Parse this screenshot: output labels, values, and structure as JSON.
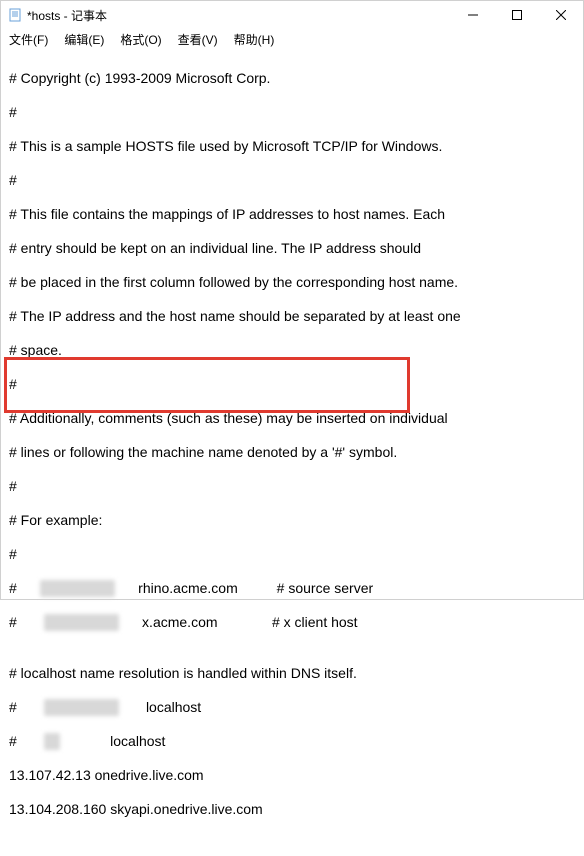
{
  "window": {
    "title": "*hosts - 记事本",
    "icon_name": "notepad-icon"
  },
  "menu": {
    "file": "文件(F)",
    "edit": "编辑(E)",
    "format": "格式(O)",
    "view": "查看(V)",
    "help": "帮助(H)"
  },
  "lines": {
    "l0": "# Copyright (c) 1993-2009 Microsoft Corp.",
    "l1": "#",
    "l2": "# This is a sample HOSTS file used by Microsoft TCP/IP for Windows.",
    "l3": "#",
    "l4": "# This file contains the mappings of IP addresses to host names. Each",
    "l5": "# entry should be kept on an individual line. The IP address should",
    "l6": "# be placed in the first column followed by the corresponding host name.",
    "l7": "# The IP address and the host name should be separated by at least one",
    "l8": "# space.",
    "l9": "#",
    "l10": "# Additionally, comments (such as these) may be inserted on individual",
    "l11": "# lines or following the machine name denoted by a '#' symbol.",
    "l12": "#",
    "l13": "# For example:",
    "l14": "#",
    "l15a": "#      ",
    "l15b": "XXXXXXXX",
    "l15c": "      rhino.acme.com          # source server",
    "l16a": "#       ",
    "l16b": "XXXXXXXX",
    "l16c": "      x.acme.com              # x client host",
    "l17": "",
    "l18": "# localhost name resolution is handled within DNS itself.",
    "l19a": "#       ",
    "l19b": "XXXXXXXX",
    "l19c": "       localhost",
    "l20a": "#       ",
    "l20b": "::1",
    "l20c": "             localhost",
    "l21": "13.107.42.13 onedrive.live.com",
    "l22": "13.104.208.160 skyapi.onedrive.live.com",
    "l23": ""
  }
}
